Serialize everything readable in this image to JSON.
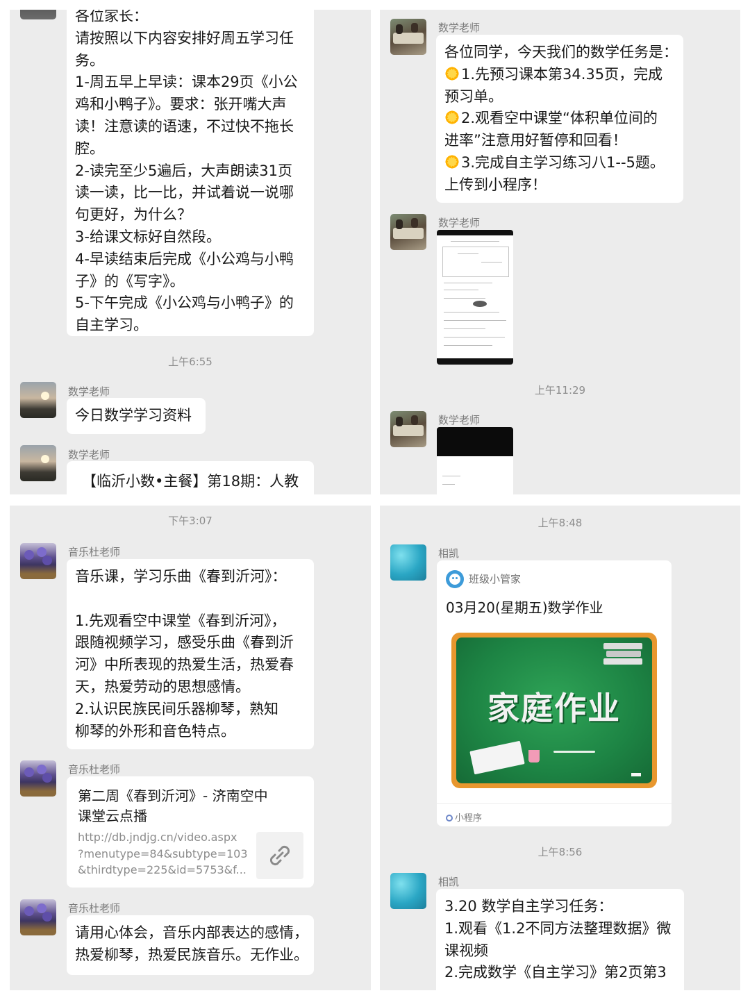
{
  "panel1": {
    "msg1_lines": [
      "各位家长：",
      "请按照以下内容安排好周五学习任",
      "务。",
      "1-周五早上早读：课本29页《小公",
      "鸡和小鸭子》。要求：张开嘴大声",
      "读！注意读的语速，不过快不拖长",
      "腔。",
      "2-读完至少5遍后，大声朗读31页",
      "读一读，比一比，并试着说一说哪",
      "句更好，为什么？",
      "3-给课文标好自然段。",
      "4-早读结束后完成《小公鸡与小鸭",
      "子》的《写字》。",
      "5-下午完成《小公鸡与小鸭子》的",
      "自主学习。"
    ],
    "time1": "上午6:55",
    "sender": "数学老师",
    "msg2": "今日数学学习资料",
    "msg3": "【临沂小数•主餐】第18期：人教"
  },
  "panel2": {
    "sender": "数学老师",
    "msg1_lines": [
      "各位同学，今天我们的数学任务是：",
      "1.先预习课本第34.35页，完成",
      "预习单。",
      "2.观看空中课堂“体积单位间的",
      "进率”注意用好暂停和回看！",
      "3.完成自主学习练习八1--5题。",
      "上传到小程序！"
    ],
    "time1": "上午11:29"
  },
  "panel3": {
    "time1": "下午3:07",
    "sender": "音乐杜老师",
    "msg1_lines": [
      "音乐课，学习乐曲《春到沂河》：",
      "",
      "  1.先观看空中课堂《春到沂河》，",
      "跟随视频学习，感受乐曲《春到沂",
      "河》中所表现的热爱生活，热爱春",
      "天，热爱劳动的思想感情。",
      "  2.认识民族民间乐器柳琴，熟知",
      "柳琴的外形和音色特点。"
    ],
    "link_title_lines": [
      "第二周《春到沂河》- 济南空中",
      "课堂云点播"
    ],
    "link_url_lines": [
      "http://db.jndjg.cn/video.aspx",
      "?menutype=84&subtype=103",
      "&thirdtype=225&id=5753&f..."
    ],
    "msg3_lines": [
      "请用心体会，音乐内部表达的感情，",
      "热爱柳琴，热爱民族音乐。无作业。"
    ]
  },
  "panel4": {
    "time1": "上午8:48",
    "sender": "相凯",
    "app_name": "班级小管家",
    "card_title": "03月20(星期五)数学作业",
    "board_text": "家庭作业",
    "mini_program": "小程序",
    "time2": "上午8:56",
    "msg2_lines": [
      "3.20 数学自主学习任务：",
      "1.观看《1.2不同方法整理数据》微",
      "课视频",
      "2.完成数学《自主学习》第2页第3"
    ]
  }
}
